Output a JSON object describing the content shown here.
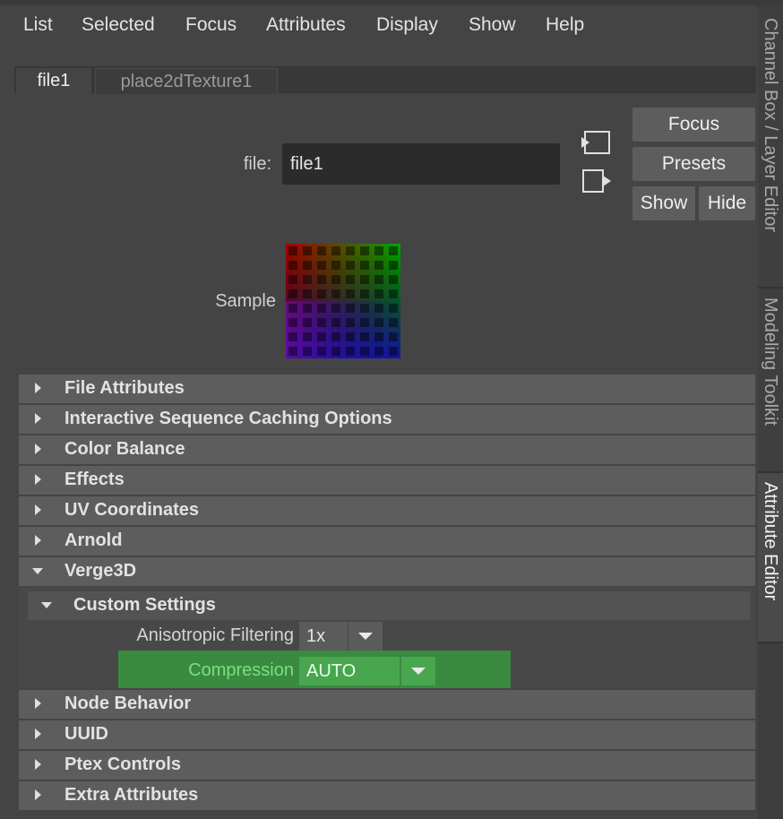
{
  "menu": [
    "List",
    "Selected",
    "Focus",
    "Attributes",
    "Display",
    "Show",
    "Help"
  ],
  "tabs": [
    "file1",
    "place2dTexture1"
  ],
  "file_field": {
    "label": "file:",
    "value": "file1"
  },
  "buttons": {
    "focus": "Focus",
    "presets": "Presets",
    "show": "Show",
    "hide": "Hide"
  },
  "sample_label": "Sample",
  "sections_top": [
    "File Attributes",
    "Interactive Sequence Caching Options",
    "Color Balance",
    "Effects",
    "UV Coordinates",
    "Arnold",
    "Verge3D"
  ],
  "custom_settings": {
    "title": "Custom Settings",
    "anisotropic": {
      "label": "Anisotropic Filtering",
      "value": "1x"
    },
    "compression": {
      "label": "Compression",
      "value": "AUTO"
    }
  },
  "sections_bottom": [
    "Node Behavior",
    "UUID",
    "Ptex Controls",
    "Extra Attributes"
  ],
  "side_tabs": [
    "Channel Box / Layer Editor",
    "Modeling Toolkit",
    "Attribute Editor"
  ],
  "colors": {
    "panel": "#444444",
    "header": "#5d5d5d",
    "highlight": "#3a8a40",
    "highlight_text": "#7be07f"
  },
  "icons": {
    "select_in": "load-input-icon",
    "select_out": "load-output-icon",
    "collapsed": "triangle-right-icon",
    "expanded": "triangle-down-icon",
    "dropdown": "triangle-down-icon"
  }
}
